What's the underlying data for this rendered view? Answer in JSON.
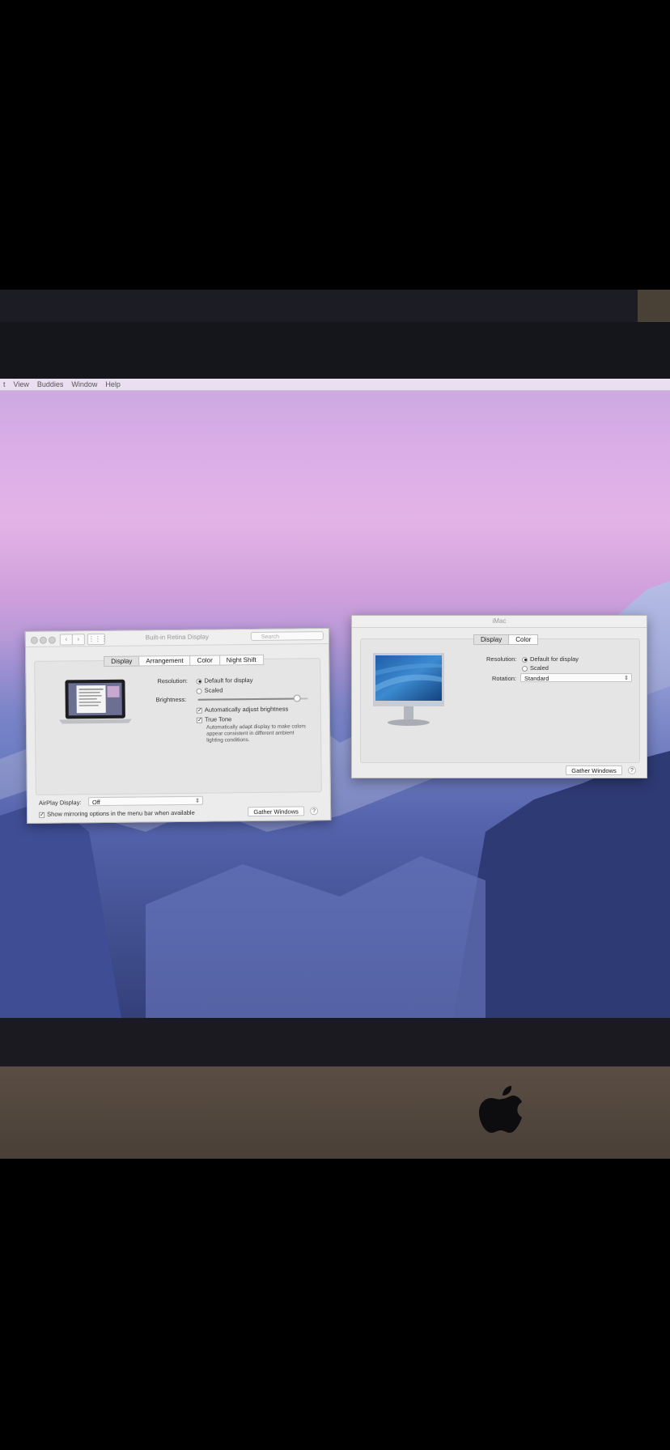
{
  "menubar": {
    "items": [
      "t",
      "View",
      "Buddies",
      "Window",
      "Help"
    ]
  },
  "win_left": {
    "title": "Built-in Retina Display",
    "search_placeholder": "Search",
    "tabs": [
      "Display",
      "Arrangement",
      "Color",
      "Night Shift"
    ],
    "selected_tab": "Display",
    "resolution_label": "Resolution:",
    "resolution_options": [
      "Default for display",
      "Scaled"
    ],
    "resolution_selected": "Default for display",
    "brightness_label": "Brightness:",
    "brightness_level": 0.9,
    "auto_brightness_label": "Automatically adjust brightness",
    "auto_brightness_checked": true,
    "true_tone_label": "True Tone",
    "true_tone_checked": true,
    "true_tone_desc": "Automatically adapt display to make colors appear consistent in different ambient lighting conditions.",
    "airplay_label": "AirPlay Display:",
    "airplay_value": "Off",
    "mirroring_label": "Show mirroring options in the menu bar when available",
    "mirroring_checked": true,
    "gather_button": "Gather Windows",
    "help_label": "?"
  },
  "win_right": {
    "title": "iMac",
    "tabs": [
      "Display",
      "Color"
    ],
    "selected_tab": "Display",
    "resolution_label": "Resolution:",
    "resolution_options": [
      "Default for display",
      "Scaled"
    ],
    "resolution_selected": "Default for display",
    "rotation_label": "Rotation:",
    "rotation_value": "Standard",
    "gather_button": "Gather Windows",
    "help_label": "?"
  },
  "icons": [
    "apple-logo",
    "laptop-preview",
    "monitor-preview"
  ]
}
